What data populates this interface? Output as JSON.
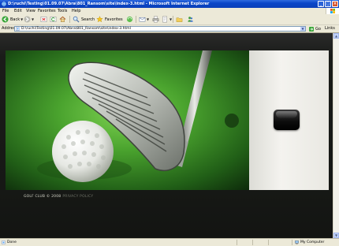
{
  "window": {
    "title": "D:\\ruchi\\Testing\\01.09.07\\Abra\\801_Ransom\\site\\index-3.html - Microsoft Internet Explorer",
    "buttons": {
      "minimize": "_",
      "maximize": "□",
      "close": "×"
    }
  },
  "menu": {
    "items": [
      "File",
      "Edit",
      "View",
      "Favorites",
      "Tools",
      "Help"
    ]
  },
  "toolbar": {
    "back_label": "Back",
    "search_label": "Search",
    "favorites_label": "Favorites"
  },
  "address": {
    "label": "Address",
    "url": "D:\\ruchi\\Testing\\01.09.07\\Abra\\801_Ransom\\site\\index-3.html",
    "go_label": "Go",
    "links_label": "Links"
  },
  "page": {
    "footer_copyright": "GOLF CLUB © 2008",
    "footer_privacy": "PRIVACY POLICY"
  },
  "status": {
    "text": "Done",
    "zone": "My Computer"
  },
  "colors": {
    "titlebar": "#0a46c8",
    "page_bg": "#161815",
    "panel": "#eeede8",
    "grass": "#3c8a28"
  }
}
